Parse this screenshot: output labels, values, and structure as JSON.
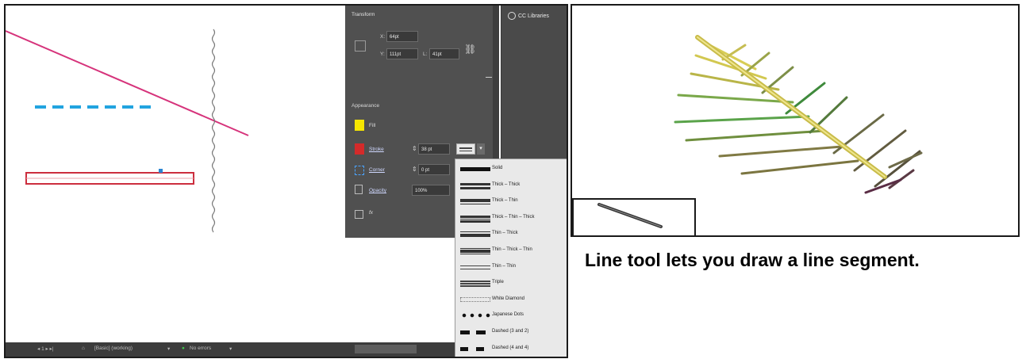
{
  "properties_panel": {
    "transform_title": "Transform",
    "x_value": "64pt",
    "y_value": "111pt",
    "h_value": "41pt",
    "appearance_title": "Appearance",
    "fill_label": "Fill",
    "stroke_label": "Stroke",
    "stroke_weight": "38 pt",
    "corner_label": "Corner",
    "corner_value": "0 pt",
    "opacity_label": "Opacity",
    "opacity_value": "100%",
    "fx_label": "fx",
    "fill_color": "#f6e600",
    "stroke_color": "#d42a2a"
  },
  "cc_libraries": {
    "tab_label": "CC Libraries"
  },
  "stroke_styles": [
    "Solid",
    "Thick – Thick",
    "Thick – Thin",
    "Thick – Thin – Thick",
    "Thin – Thick",
    "Thin – Thick – Thin",
    "Thin – Thin",
    "Triple",
    "White Diamond",
    "Japanese Dots",
    "Dashed (3 and 2)",
    "Dashed (4 and 4)"
  ],
  "status_bar": {
    "workspace": "[Basic] (working)",
    "errors": "No errors"
  },
  "caption": "Line tool lets you draw a line segment."
}
